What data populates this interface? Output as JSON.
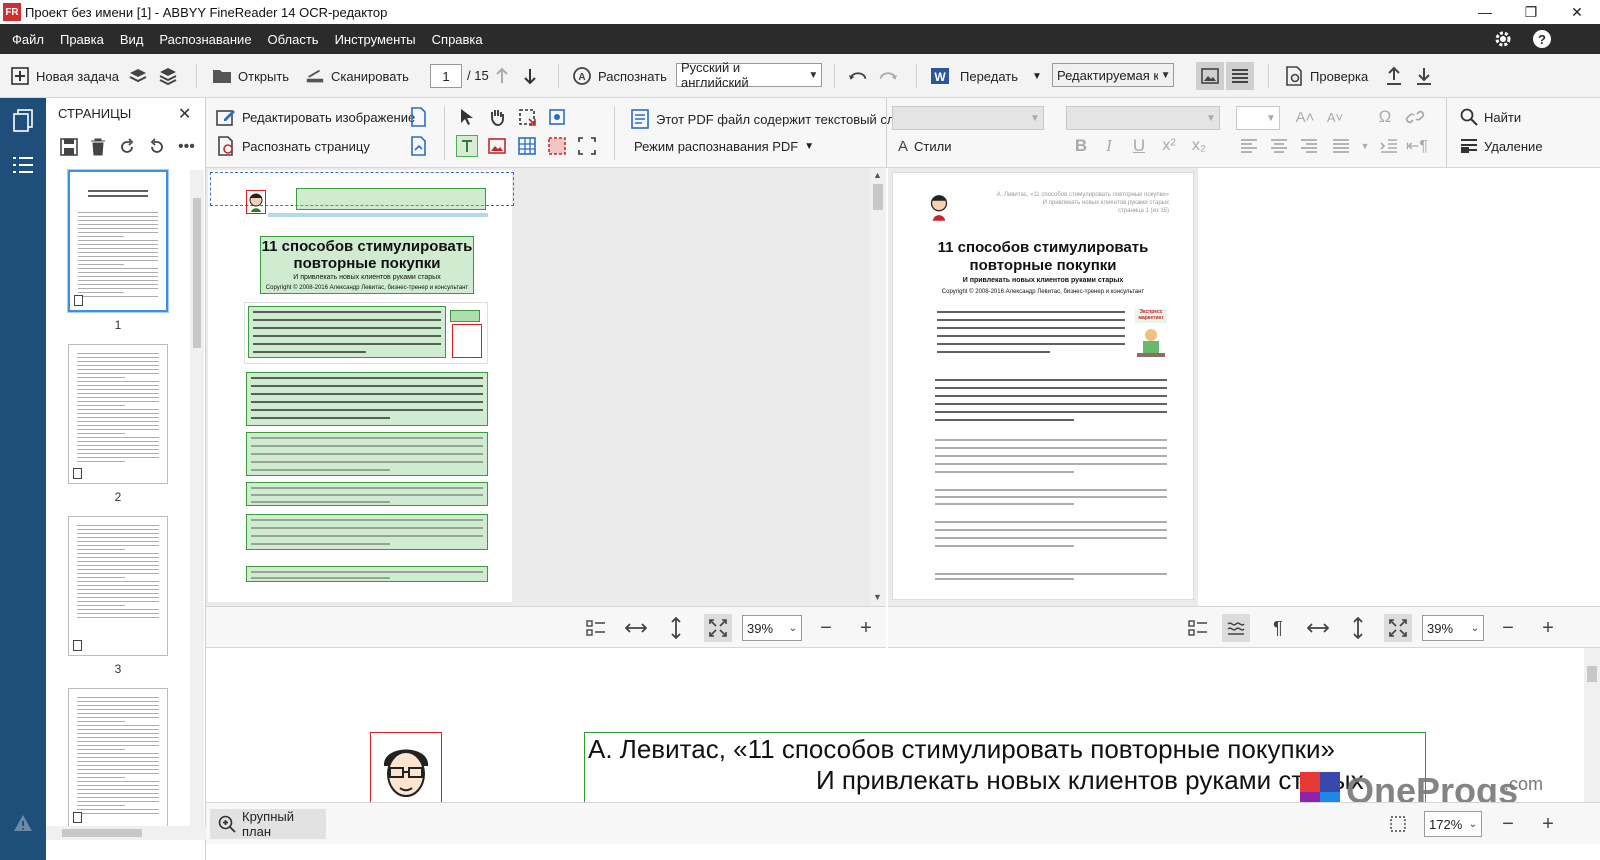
{
  "window": {
    "title": "Проект без имени [1] - ABBYY FineReader 14 OCR-редактор",
    "logo": "FR",
    "minimize": "—",
    "maximize": "❐",
    "close": "✕"
  },
  "menu": [
    "Файл",
    "Правка",
    "Вид",
    "Распознавание",
    "Область",
    "Инструменты",
    "Справка"
  ],
  "toolbar": {
    "new_task": "Новая задача",
    "open": "Открыть",
    "scan": "Сканировать",
    "page_current": "1",
    "page_total": "/ 15",
    "recognize": "Распознать",
    "language": "Русский и английский",
    "send": "Передать",
    "mode": "Редактируемая ко",
    "check": "Проверка"
  },
  "pages_panel": {
    "title": "СТРАНИЦЫ",
    "pages": [
      "1",
      "2",
      "3"
    ]
  },
  "toolbar2": {
    "edit_image": "Редактировать изображение",
    "recognize_page": "Распознать страницу",
    "pdf_text_layer": "Этот PDF файл содержит текстовый слой",
    "pdf_mode": "Режим распознавания PDF",
    "styles": "Стили",
    "find": "Найти",
    "delete": "Удаление"
  },
  "document": {
    "header_line1": "А. Левитас, «11 способов стимулировать повторные покупки»",
    "header_line2": "И привлекать новых клиентов руками старых",
    "header_line3": "страница 1 (из 15)",
    "title_line1": "11 способов стимулировать",
    "title_line2": "повторные покупки",
    "subtitle": "И привлекать новых клиентов руками старых",
    "copyright": "Copyright © 2008-2016 Александр Левитас, бизнес-тренер и консультант",
    "badge": "Экспресс маркетинг",
    "text_copyright": "Copyright © 2008-2016 Александр Левитас, бизнес-тренер и консультант"
  },
  "zoom": {
    "image": "39%",
    "text": "39%",
    "closeup": "172%"
  },
  "closeup": {
    "line1": "А. Левитас, «11 способов стимулировать повторные покупки»",
    "line2": "И привлекать новых клиентов руками старых",
    "button": "Крупный план"
  },
  "watermark": {
    "brand": "OneProgs",
    "suffix": ".com"
  }
}
